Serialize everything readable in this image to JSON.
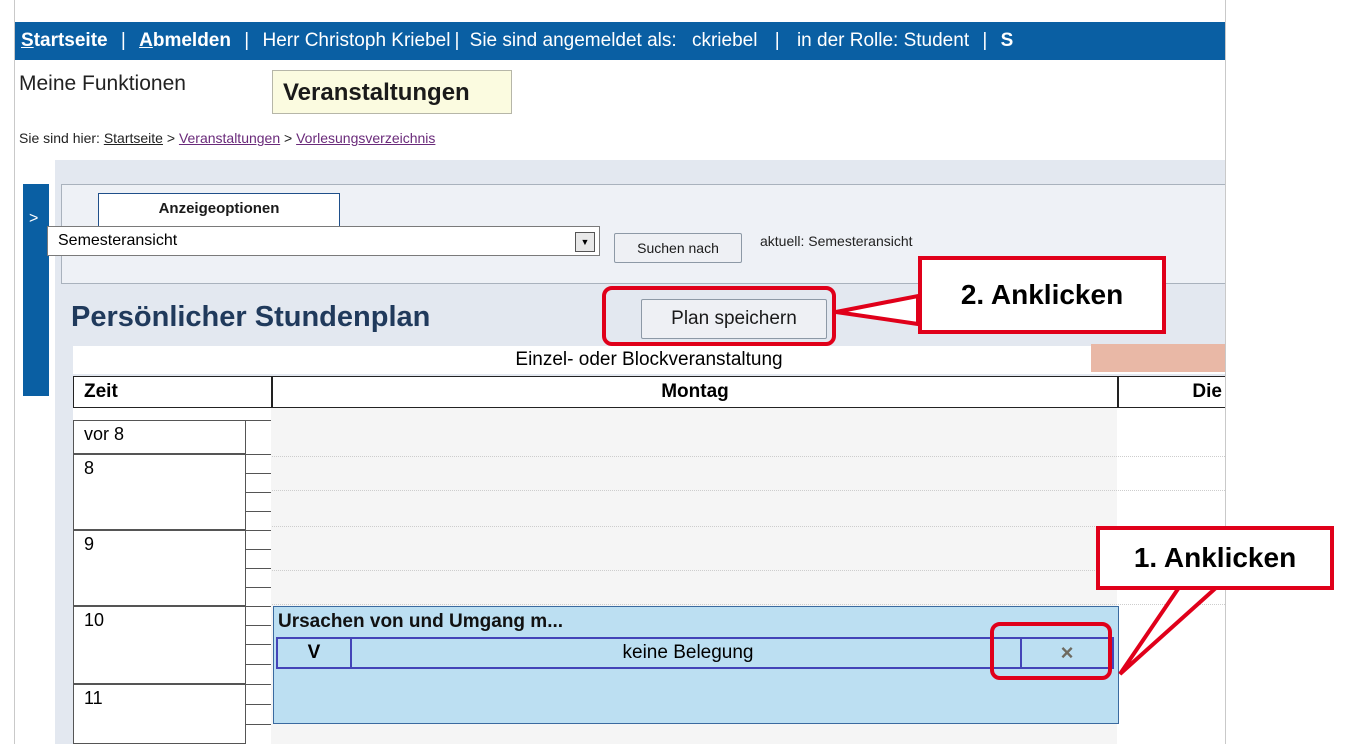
{
  "topbar": {
    "home_first": "S",
    "home_rest": "tartseite",
    "logout_first": "A",
    "logout_rest": "bmelden",
    "user": "Herr Christoph Kriebel",
    "login_text": "Sie sind angemeldet als:",
    "username": "ckriebel",
    "role_text": "in der Rolle: Student",
    "next_link": "S"
  },
  "functions": {
    "label": "Meine Funktionen",
    "active_button": "Veranstaltungen"
  },
  "breadcrumb": {
    "prefix": "Sie sind hier:",
    "items": [
      "Startseite",
      "Veranstaltungen",
      "Vorlesungsverzeichnis"
    ],
    "separator": ">"
  },
  "sidebar": {
    "toggle": ">"
  },
  "options": {
    "tab_label": "Anzeigeoptionen",
    "select_value": "Semesteransicht",
    "search_button": "Suchen nach",
    "current": "aktuell: Semesteransicht"
  },
  "schedule": {
    "title": "Persönlicher Stundenplan",
    "save_button": "Plan speichern",
    "legend": "Einzel- oder Blockveranstaltung",
    "columns": [
      "Zeit",
      "Montag",
      "Die"
    ],
    "rows": [
      "vor 8",
      "8",
      "9",
      "10",
      "11"
    ],
    "event": {
      "title": "Ursachen von und Umgang m...",
      "type": "V",
      "room": "keine Belegung",
      "remove_icon": "×"
    }
  },
  "callouts": {
    "step1": "1. Anklicken",
    "step2": "2. Anklicken"
  },
  "colors": {
    "topbar": "#0a5fa3",
    "event": "#bcdff2",
    "highlight": "#e0001a"
  }
}
